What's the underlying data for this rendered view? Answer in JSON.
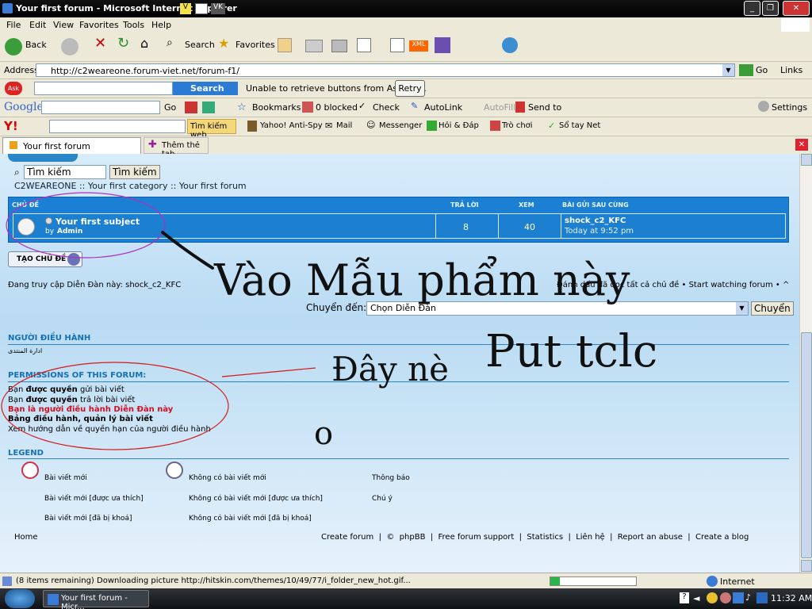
{
  "window": {
    "title": "Your first forum - Microsoft Internet Explorer",
    "tray_badge_1": "V",
    "tray_badge_2": "VK"
  },
  "menu": [
    "File",
    "Edit",
    "View",
    "Favorites",
    "Tools",
    "Help"
  ],
  "toolbar": {
    "back": "Back",
    "search": "Search",
    "favorites": "Favorites"
  },
  "address": {
    "label": "Address",
    "url": "http://c2weareone.forum-viet.net/forum-f1/",
    "go": "Go",
    "links": "Links"
  },
  "ask_bar": {
    "search_btn": "Search",
    "message": "Unable to retrieve buttons from Ask.com.",
    "retry": "Retry"
  },
  "google_bar": {
    "logo": "Google",
    "go": "Go",
    "bookmarks": "Bookmarks",
    "blocked": "0 blocked",
    "check": "Check",
    "autolink": "AutoLink",
    "autofill": "AutoFill",
    "sendto": "Send to",
    "settings": "Settings"
  },
  "yahoo_bar": {
    "search_web": "Tìm kiếm web",
    "antispy": "Yahoo! Anti-Spy",
    "mail": "Mail",
    "messenger": "Messenger",
    "hoidap": "Hỏi & Đáp",
    "trochoi": "Trò chơi",
    "sotay": "Sổ tay Net"
  },
  "tabs": {
    "active": "Your first forum",
    "new_tab": "Thêm thẻ tab"
  },
  "page": {
    "search_placeholder": "Tìm kiếm",
    "search_btn": "Tìm kiếm",
    "breadcrumb": "C2WEAREONE :: Your first category :: Your first forum",
    "table": {
      "col_topic": "CHỦ ĐỀ",
      "col_replies": "TRẢ LỜI",
      "col_views": "XEM",
      "col_last": "BÀI GỬI SAU CÙNG",
      "topic_title": "Your first subject",
      "topic_by_label": "by",
      "topic_author": "Admin",
      "replies": "8",
      "views": "40",
      "last_user": "shock_c2_KFC",
      "last_time": "Today at 9:52 pm"
    },
    "new_topic_btn": "TẠO CHỦ ĐỀ",
    "visiting": "Đang truy cập Diễn Đàn này: shock_c2_KFC",
    "mark_read": "Đánh dấu đã đọc tất cả chủ đề • Start watching forum • ^",
    "jump_label": "Chuyển đến:",
    "jump_select": "Chọn Diễn Đàn",
    "jump_btn": "Chuyển",
    "moderators_title": "NGƯỜI ĐIỀU HÀNH",
    "moderators_value": "ادارة المنتدى",
    "permissions_title": "PERMISSIONS OF THIS FORUM:",
    "perm_1a": "Bạn ",
    "perm_1b": "được quyền",
    "perm_1c": " gửi bài viết",
    "perm_2a": "Bạn ",
    "perm_2b": "được quyền",
    "perm_2c": " trả lời bài viết",
    "perm_3": "Bạn là người điều hành Diễn Đàn này",
    "perm_4": "Bảng điều hành, quản lý bài viết",
    "perm_5": "Xem hướng dẫn về quyền hạn của người điều hành",
    "legend_title": "LEGEND",
    "legend": [
      [
        "Bài viết mới",
        "Không có bài viết mới",
        "Thông báo"
      ],
      [
        "Bài viết mới [được ưa thích]",
        "Không có bài viết mới [được ưa thích]",
        "Chú ý"
      ],
      [
        "Bài viết mới [đã bị khoá]",
        "Không có bài viết mới [đã bị khoá]",
        ""
      ]
    ],
    "footer_home": "Home",
    "footer_links": "Create forum  |  ©  phpBB  |  Free forum support  |  Statistics  |  Liên hệ  |  Report an abuse  |  Create a blog"
  },
  "annotation": {
    "line1": "Vào Mẫu phẩm này",
    "line2": "Đây nè",
    "line3": "Put tclc",
    "line4": "o"
  },
  "status": {
    "text": "(8 items remaining) Downloading picture http://hitskin.com/themes/10/49/77/i_folder_new_hot.gif...",
    "zone": "Internet"
  },
  "taskbar": {
    "task": "Your first forum - Micr...",
    "clock": "11:32 AM",
    "help": "?"
  }
}
